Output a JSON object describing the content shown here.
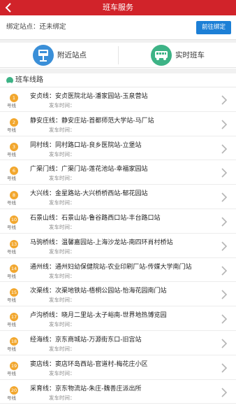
{
  "header": {
    "title": "班车服务",
    "back_icon": "chevron-left-icon"
  },
  "bind": {
    "status": "绑定站点：还未绑定",
    "button_label": "前往绑定"
  },
  "entries": [
    {
      "label": "附近站点",
      "icon": "bus-stop-icon",
      "color": "#3a8fd8"
    },
    {
      "label": "实时班车",
      "icon": "bus-icon",
      "color": "#3db386"
    }
  ],
  "section": {
    "title": "班车线路",
    "icon": "route-icon"
  },
  "route_suffix": "号线",
  "routes": [
    {
      "num": "1",
      "text": "安贞线：安贞医院北站-潘家园站-玉泉营站",
      "depart": "发车时间："
    },
    {
      "num": "2",
      "text": "静安庄线：静安庄站-首都师范大学站-马厂站",
      "depart": "发车时间："
    },
    {
      "num": "3",
      "text": "同村线：同村路口站-良乡医院站-立堡站",
      "depart": "发车时间："
    },
    {
      "num": "6",
      "text": "广渠门线：广渠门站-莲花池站-幸福家园站",
      "depart": "发车时间："
    },
    {
      "num": "8",
      "text": "大兴线：金星路站-大兴桥桥西站-郁花园站",
      "depart": "发车时间："
    },
    {
      "num": "10",
      "text": "石景山线：石景山站-鲁谷路西口站-丰台路口站",
      "depart": "发车时间："
    },
    {
      "num": "13",
      "text": "马驹桥线：温馨嘉园站-上海沙龙站-南四环肖村桥站",
      "depart": "发车时间："
    },
    {
      "num": "14",
      "text": "通州线：通州妇幼保健院站-农业印刷厂站-传媒大学南门站",
      "depart": "发车时间："
    },
    {
      "num": "15",
      "text": "次渠线：次渠地铁站-梧桐公园站-怡海花园南门站",
      "depart": "发车时间："
    },
    {
      "num": "17",
      "text": "卢沟桥线：晓月二里站-太子峪南-世界地热博览园",
      "depart": "发车时间："
    },
    {
      "num": "18",
      "text": "经海线：京东商城站-万源街东口-旧宫站",
      "depart": "发车时间："
    },
    {
      "num": "19",
      "text": "窦店线：窦店环岛西站-官道村-梅花庄小区",
      "depart": "发车时间："
    },
    {
      "num": "20",
      "text": "采育线：京东物流站-朱庄-魏善庄派出所",
      "depart": "发车时间："
    }
  ]
}
